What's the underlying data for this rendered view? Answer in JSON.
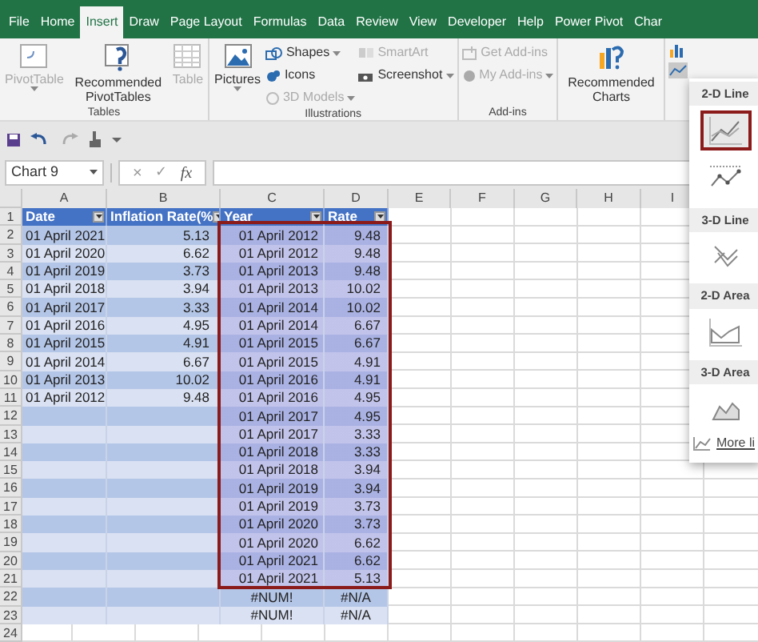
{
  "tabs": [
    {
      "label": "File",
      "selected": false
    },
    {
      "label": "Home",
      "selected": false
    },
    {
      "label": "Insert",
      "selected": true
    },
    {
      "label": "Draw",
      "selected": false
    },
    {
      "label": "Page Layout",
      "selected": false
    },
    {
      "label": "Formulas",
      "selected": false
    },
    {
      "label": "Data",
      "selected": false
    },
    {
      "label": "Review",
      "selected": false
    },
    {
      "label": "View",
      "selected": false
    },
    {
      "label": "Developer",
      "selected": false
    },
    {
      "label": "Help",
      "selected": false
    },
    {
      "label": "Power Pivot",
      "selected": false
    },
    {
      "label": "Char",
      "selected": false
    }
  ],
  "ribbon_groups": [
    {
      "label": "Tables",
      "buttons": [
        {
          "kind": "large",
          "label": "PivotTable",
          "disabled": true,
          "dropdown": true
        },
        {
          "kind": "large",
          "label": "Recommended PivotTables",
          "disabled": false,
          "dropdown": false
        },
        {
          "kind": "large",
          "label": "Table",
          "disabled": true,
          "dropdown": false
        }
      ]
    },
    {
      "label": "Illustrations",
      "buttons": [
        {
          "kind": "large",
          "label": "Pictures",
          "disabled": false,
          "dropdown": true
        },
        {
          "kind": "small",
          "label": "Shapes",
          "disabled": false,
          "dropdown": true
        },
        {
          "kind": "small",
          "label": "Icons",
          "disabled": false,
          "dropdown": false
        },
        {
          "kind": "small",
          "label": "3D Models",
          "disabled": true,
          "dropdown": true
        },
        {
          "kind": "small",
          "label": "SmartArt",
          "disabled": true,
          "dropdown": false
        },
        {
          "kind": "small",
          "label": "Screenshot",
          "disabled": false,
          "dropdown": true
        }
      ]
    },
    {
      "label": "Add-ins",
      "buttons": [
        {
          "kind": "small",
          "label": "Get Add-ins",
          "disabled": true,
          "dropdown": false
        },
        {
          "kind": "small",
          "label": "My Add-ins",
          "disabled": true,
          "dropdown": true
        }
      ]
    },
    {
      "buttons": [
        {
          "kind": "large",
          "label": "Recommended Charts",
          "disabled": false,
          "dropdown": false
        }
      ]
    }
  ],
  "name_box": "Chart 9",
  "formula_bar": {
    "cancel": "×",
    "enter": "✓",
    "function": "fx"
  },
  "columns": [
    "A",
    "B",
    "C",
    "D",
    "E",
    "F",
    "G",
    "H",
    "I"
  ],
  "table": {
    "header_row_number": "1",
    "headers": [
      "Date",
      "Inflation Rate(%",
      "Year",
      "Rate"
    ],
    "rows": [
      {
        "number": "2",
        "date": "01 April 2021",
        "inflation_rate": "5.13",
        "year": "01 April 2012",
        "rate": "9.48",
        "selected": true
      },
      {
        "number": "3",
        "date": "01 April 2020",
        "inflation_rate": "6.62",
        "year": "01 April 2012",
        "rate": "9.48",
        "selected": true
      },
      {
        "number": "4",
        "date": "01 April 2019",
        "inflation_rate": "3.73",
        "year": "01 April 2013",
        "rate": "9.48",
        "selected": true
      },
      {
        "number": "5",
        "date": "01 April 2018",
        "inflation_rate": "3.94",
        "year": "01 April 2013",
        "rate": "10.02",
        "selected": true
      },
      {
        "number": "6",
        "date": "01 April 2017",
        "inflation_rate": "3.33",
        "year": "01 April 2014",
        "rate": "10.02",
        "selected": true
      },
      {
        "number": "7",
        "date": "01 April 2016",
        "inflation_rate": "4.95",
        "year": "01 April 2014",
        "rate": "6.67",
        "selected": true
      },
      {
        "number": "8",
        "date": "01 April 2015",
        "inflation_rate": "4.91",
        "year": "01 April 2015",
        "rate": "6.67",
        "selected": true
      },
      {
        "number": "9",
        "date": "01 April 2014",
        "inflation_rate": "6.67",
        "year": "01 April 2015",
        "rate": "4.91",
        "selected": true
      },
      {
        "number": "10",
        "date": "01 April 2013",
        "inflation_rate": "10.02",
        "year": "01 April 2016",
        "rate": "4.91",
        "selected": true
      },
      {
        "number": "11",
        "date": "01 April 2012",
        "inflation_rate": "9.48",
        "year": "01 April 2016",
        "rate": "4.95",
        "selected": true
      },
      {
        "number": "12",
        "year": "01 April 2017",
        "rate": "4.95",
        "selected": true
      },
      {
        "number": "13",
        "year": "01 April 2017",
        "rate": "3.33",
        "selected": true
      },
      {
        "number": "14",
        "year": "01 April 2018",
        "rate": "3.33",
        "selected": true
      },
      {
        "number": "15",
        "year": "01 April 2018",
        "rate": "3.94",
        "selected": true
      },
      {
        "number": "16",
        "year": "01 April 2019",
        "rate": "3.94",
        "selected": true
      },
      {
        "number": "17",
        "year": "01 April 2019",
        "rate": "3.73",
        "selected": true
      },
      {
        "number": "18",
        "year": "01 April 2020",
        "rate": "3.73",
        "selected": true
      },
      {
        "number": "19",
        "year": "01 April 2020",
        "rate": "6.62",
        "selected": true
      },
      {
        "number": "20",
        "year": "01 April 2021",
        "rate": "6.62",
        "selected": true
      },
      {
        "number": "21",
        "year": "01 April 2021",
        "rate": "5.13",
        "selected": true
      },
      {
        "number": "22",
        "year": "#NUM!",
        "rate": "#N/A",
        "selected": false
      },
      {
        "number": "23",
        "year": "#NUM!",
        "rate": "#N/A",
        "selected": false
      }
    ]
  },
  "empty_rows": [
    "24"
  ],
  "chart_menu": {
    "sections": [
      {
        "label": "2-D Line",
        "items": [
          {
            "kind": "line",
            "selected": true
          },
          {
            "kind": "line-markers",
            "selected": false
          }
        ]
      },
      {
        "label": "3-D Line",
        "items": [
          {
            "kind": "line-3d",
            "selected": false
          }
        ]
      },
      {
        "label": "2-D Area",
        "items": [
          {
            "kind": "area",
            "selected": false
          }
        ]
      },
      {
        "label": "3-D Area",
        "items": [
          {
            "kind": "area-3d",
            "selected": false
          }
        ]
      }
    ],
    "more": "More li"
  }
}
